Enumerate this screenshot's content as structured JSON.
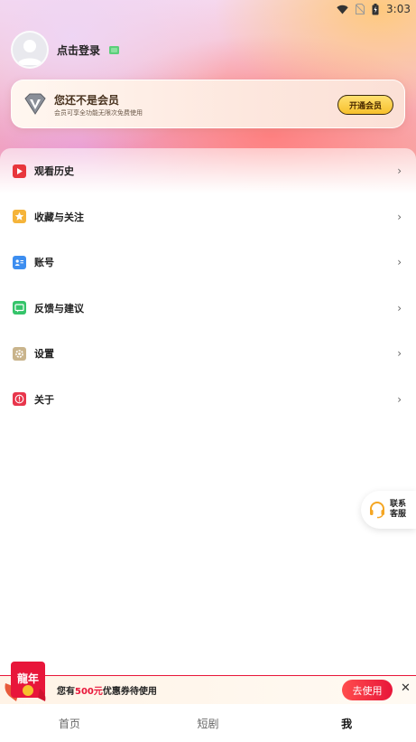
{
  "status_bar": {
    "time": "3:03"
  },
  "profile": {
    "login_text": "点击登录"
  },
  "vip": {
    "title": "您还不是会员",
    "subtitle": "会员可享全功能无限次免费使用",
    "button": "开通会员"
  },
  "menu": {
    "items": [
      {
        "label": "观看历史",
        "icon": "play-history-icon",
        "color": "#e8363c"
      },
      {
        "label": "收藏与关注",
        "icon": "star-icon",
        "color": "#f5b43a"
      },
      {
        "label": "账号",
        "icon": "id-card-icon",
        "color": "#3d8ef0"
      },
      {
        "label": "反馈与建议",
        "icon": "feedback-icon",
        "color": "#35c46a"
      },
      {
        "label": "设置",
        "icon": "gear-icon",
        "color": "#c9b48c"
      },
      {
        "label": "关于",
        "icon": "info-icon",
        "color": "#e8364c"
      }
    ],
    "chevron": "›"
  },
  "customer_service": {
    "label_line1": "联系",
    "label_line2": "客服"
  },
  "coupon": {
    "badge": "龍年",
    "prefix": "您有",
    "amount": "500元",
    "suffix": "优惠券待使用",
    "button": "去使用",
    "close": "✕"
  },
  "tabs": [
    {
      "label": "首页",
      "active": false
    },
    {
      "label": "短剧",
      "active": false
    },
    {
      "label": "我",
      "active": true
    }
  ],
  "colors": {
    "accent": "#e8163a",
    "vip_gold": "#f7c02c"
  }
}
